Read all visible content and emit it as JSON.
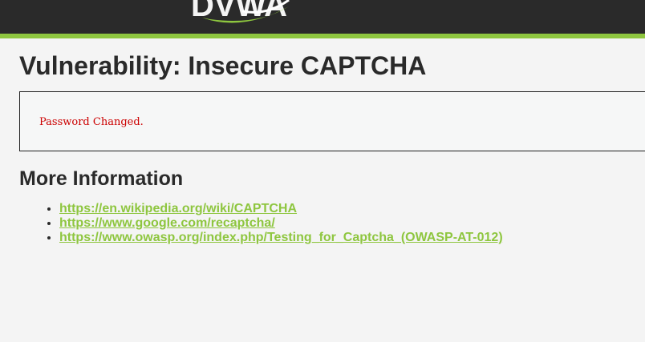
{
  "page": {
    "title": "Vulnerability: Insecure CAPTCHA",
    "result_message": "Password Changed.",
    "more_info_heading": "More Information"
  },
  "links": [
    {
      "text": "https://en.wikipedia.org/wiki/CAPTCHA"
    },
    {
      "text": "https://www.google.com/recaptcha/"
    },
    {
      "text": "https://www.owasp.org/index.php/Testing_for_Captcha_(OWASP-AT-012)"
    }
  ],
  "colors": {
    "header_bg": "#2a2a2a",
    "accent_green": "#8ec63f",
    "error_red": "#cc0000",
    "page_bg": "#f4f4f4"
  },
  "icons": {
    "logo": "dvwa-logo"
  }
}
